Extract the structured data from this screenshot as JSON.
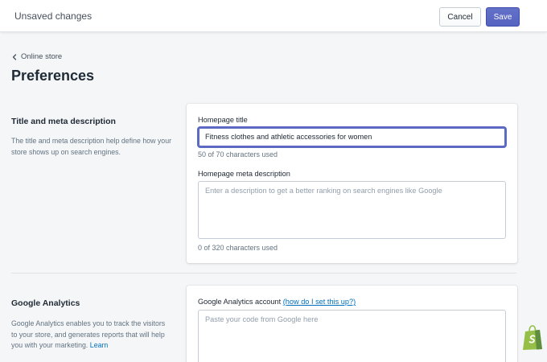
{
  "topbar": {
    "title": "Unsaved changes",
    "cancel_label": "Cancel",
    "save_label": "Save"
  },
  "header": {
    "breadcrumb": "Online store",
    "title": "Preferences"
  },
  "sections": [
    {
      "heading": "Title and meta description",
      "description": "The title and meta description help define how your store shows up on search engines.",
      "fields": {
        "homepage_title_label": "Homepage title",
        "homepage_title_value": "Fitness clothes and athletic accessories for women",
        "homepage_title_counter": "50 of 70 characters used",
        "meta_description_label": "Homepage meta description",
        "meta_description_placeholder": "Enter a description to get a better ranking on search engines like Google",
        "meta_description_counter": "0 of 320 characters used"
      }
    },
    {
      "heading": "Google Analytics",
      "description": "Google Analytics enables you to track the visitors to your store, and generates reports that will help you with your marketing.",
      "learn_link": "Learn",
      "fields": {
        "account_label": "Google Analytics account",
        "account_help_link": "(how do I set this up?)",
        "account_placeholder": "Paste your code from Google here"
      }
    }
  ],
  "icons": {
    "breadcrumb": "chevron-left-icon",
    "brand": "shopify-bag-icon"
  },
  "colors": {
    "primary": "#5c6ac4",
    "link": "#006fbb",
    "background": "#f4f6f8",
    "brand": "#95bf47"
  }
}
